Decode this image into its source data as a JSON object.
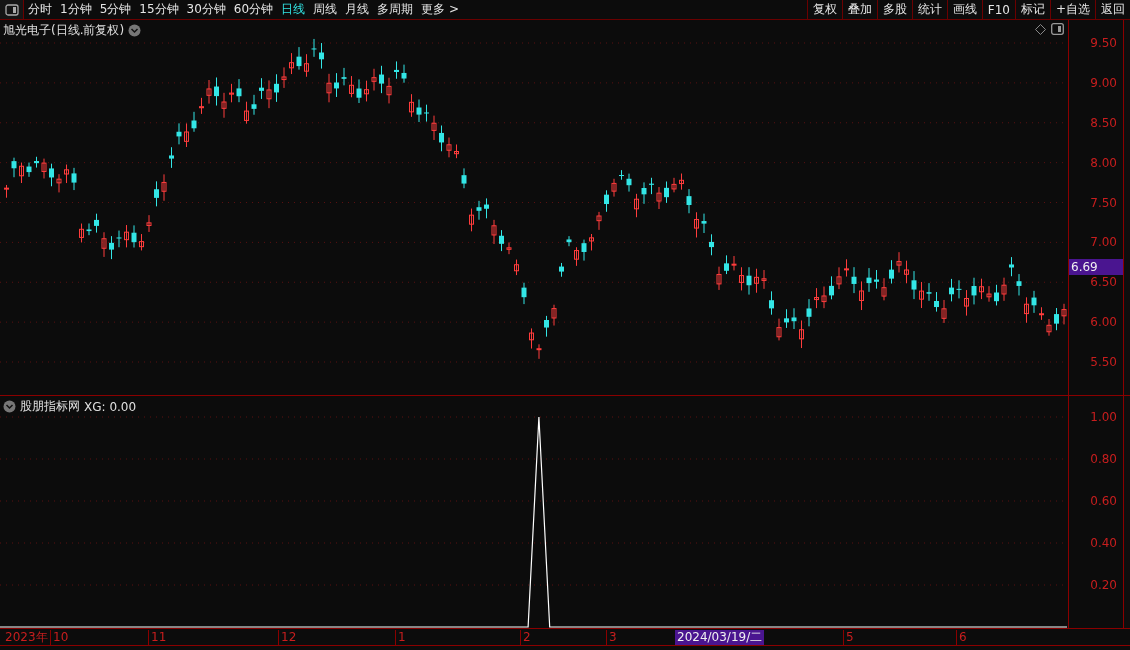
{
  "toolbar": {
    "periods": [
      {
        "label": "分时",
        "selected": false
      },
      {
        "label": "1分钟",
        "selected": false
      },
      {
        "label": "5分钟",
        "selected": false
      },
      {
        "label": "15分钟",
        "selected": false
      },
      {
        "label": "30分钟",
        "selected": false
      },
      {
        "label": "60分钟",
        "selected": false
      },
      {
        "label": "日线",
        "selected": true
      },
      {
        "label": "周线",
        "selected": false
      },
      {
        "label": "月线",
        "selected": false
      },
      {
        "label": "多周期",
        "selected": false
      },
      {
        "label": "更多 >",
        "selected": false
      }
    ],
    "buttons": [
      "复权",
      "叠加",
      "多股",
      "统计",
      "画线",
      "F10",
      "标记",
      "+自选",
      "返回"
    ]
  },
  "price_chart": {
    "title": "旭光电子(日线.前复权)",
    "axis_labels": [
      "9.50",
      "9.00",
      "8.50",
      "8.00",
      "7.50",
      "7.00",
      "6.50",
      "6.00",
      "5.50"
    ],
    "current_price": "6.69"
  },
  "indicator": {
    "title": "股朋指标网",
    "reading": ": 0.00",
    "chart_data": {
      "type": "line",
      "grid": true,
      "ylim": [
        0,
        1
      ],
      "yticks": [
        {
          "value": 1,
          "label": "1.00"
        },
        {
          "value": 0.8,
          "label": "0.80"
        },
        {
          "value": 0.6,
          "label": "0.60"
        },
        {
          "value": 0.4,
          "label": "0.40"
        },
        {
          "value": 0.2,
          "label": "0.20"
        }
      ],
      "series": [
        {
          "name": "XG",
          "color": "#ffffff",
          "values": [
            0,
            0,
            0,
            0,
            0,
            0,
            0,
            0,
            0,
            0,
            0,
            0,
            0,
            0,
            0,
            0,
            0,
            0,
            0,
            0,
            0,
            0,
            0,
            0,
            0,
            0,
            0,
            0,
            0,
            0,
            0,
            0,
            0,
            0,
            0,
            0,
            0,
            0,
            0,
            0,
            0,
            0,
            0,
            0,
            0,
            0,
            0,
            0,
            0,
            0,
            1,
            0,
            0,
            0,
            0,
            0,
            0,
            0,
            0,
            0,
            0,
            0,
            0,
            0,
            0,
            0,
            0,
            0,
            0,
            0,
            0,
            0,
            0,
            0,
            0,
            0,
            0,
            0,
            0,
            0,
            0,
            0,
            0,
            0,
            0,
            0,
            0,
            0,
            0,
            0,
            0,
            0,
            0,
            0,
            0,
            0,
            0,
            0,
            0,
            0
          ]
        }
      ]
    }
  },
  "date_axis": [
    {
      "label": "2023年",
      "kind": "year"
    },
    {
      "label": "10",
      "kind": "month"
    },
    {
      "label": "11",
      "kind": "month"
    },
    {
      "label": "12",
      "kind": "month"
    },
    {
      "label": "1",
      "kind": "month"
    },
    {
      "label": "2",
      "kind": "month"
    },
    {
      "label": "3",
      "kind": "month"
    },
    {
      "label": "2024/03/19/二",
      "kind": "cursor"
    },
    {
      "label": "5",
      "kind": "month"
    },
    {
      "label": "6",
      "kind": "month"
    }
  ]
}
